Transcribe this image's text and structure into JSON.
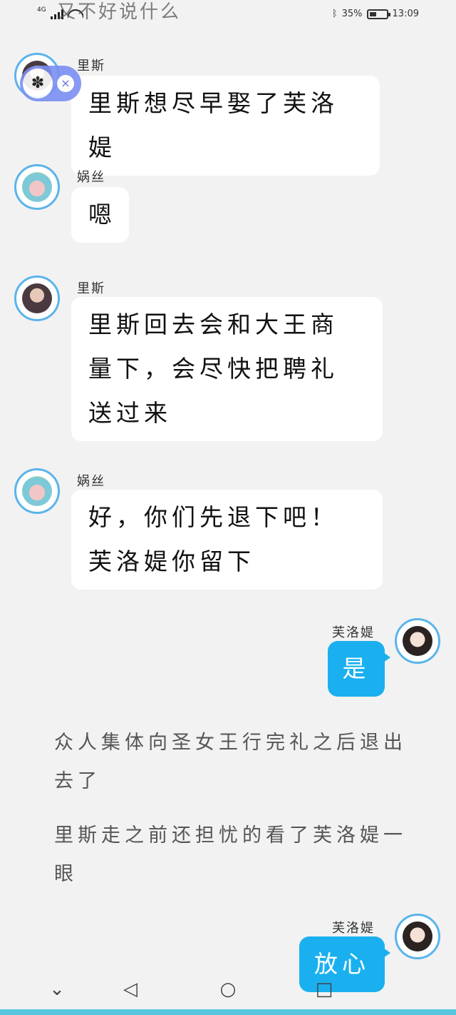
{
  "status": {
    "title": "又不好说什么",
    "network": "4G",
    "battery_pct": "35%",
    "time": "13:09"
  },
  "messages": [
    {
      "sender": "里斯",
      "text": "里斯想尽早娶了芙洛媞"
    },
    {
      "sender": "娲丝",
      "text": "嗯"
    },
    {
      "sender": "里斯",
      "text": "里斯回去会和大王商量下，会尽快把聘礼送过来"
    },
    {
      "sender": "娲丝",
      "text": "好，你们先退下吧！芙洛媞你留下"
    },
    {
      "sender": "芙洛媞",
      "text": "是"
    }
  ],
  "narration": [
    "众人集体向圣女王行完礼之后退出去了",
    "里斯走之前还担忧的看了芙洛媞一眼"
  ],
  "last_message": {
    "sender": "芙洛媞",
    "text": "放心"
  },
  "floating_ball": {
    "close": "×",
    "icon": "paw-icon"
  },
  "nav": {
    "down": "⌄",
    "back": "◁",
    "home": "○",
    "recent": "□"
  },
  "colors": {
    "my_bubble": "#1ab0ef",
    "avatar_ring": "#5ab4ec",
    "background": "#f2f2f2"
  }
}
